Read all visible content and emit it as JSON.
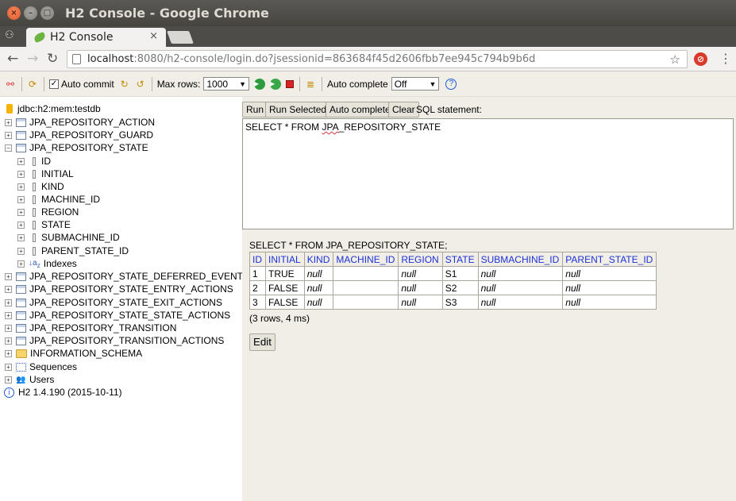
{
  "window": {
    "title": "H2 Console - Google Chrome"
  },
  "browser": {
    "tab_label": "H2 Console",
    "tab_close": "×",
    "url_host": "localhost",
    "url_rest": ":8080/h2-console/login.do?jsessionid=863684f45d2606fbb7ee945c794b9b6d",
    "icons": [
      "incognito-icon",
      "back-icon",
      "forward-icon",
      "reload-icon",
      "lock-icon",
      "star-icon",
      "extension-icon",
      "menu-icon"
    ]
  },
  "toolbar": {
    "auto_commit": "Auto commit",
    "auto_commit_checked": true,
    "max_rows_label": "Max rows:",
    "max_rows_value": "1000",
    "auto_complete_label": "Auto complete",
    "auto_complete_value": "Off"
  },
  "tree": {
    "connection": "jdbc:h2:mem:testdb",
    "tables_before": [
      "JPA_REPOSITORY_ACTION",
      "JPA_REPOSITORY_GUARD"
    ],
    "expanded_table": "JPA_REPOSITORY_STATE",
    "columns": [
      "ID",
      "INITIAL",
      "KIND",
      "MACHINE_ID",
      "REGION",
      "STATE",
      "SUBMACHINE_ID",
      "PARENT_STATE_ID"
    ],
    "indexes": "Indexes",
    "tables_after": [
      "JPA_REPOSITORY_STATE_DEFERRED_EVENTS",
      "JPA_REPOSITORY_STATE_ENTRY_ACTIONS",
      "JPA_REPOSITORY_STATE_EXIT_ACTIONS",
      "JPA_REPOSITORY_STATE_STATE_ACTIONS",
      "JPA_REPOSITORY_TRANSITION",
      "JPA_REPOSITORY_TRANSITION_ACTIONS"
    ],
    "info_schema": "INFORMATION_SCHEMA",
    "sequences": "Sequences",
    "users": "Users",
    "version": "H2 1.4.190 (2015-10-11)"
  },
  "query": {
    "run": "Run",
    "run_selected": "Run Selected",
    "auto_complete": "Auto complete",
    "clear": "Clear",
    "sql_label": "SQL statement:",
    "sql_prefix": "SELECT * FROM ",
    "sql_jpa": "JPA",
    "sql_suffix": "_REPOSITORY_STATE"
  },
  "result": {
    "title": "SELECT * FROM JPA_REPOSITORY_STATE;",
    "columns": [
      "ID",
      "INITIAL",
      "KIND",
      "MACHINE_ID",
      "REGION",
      "STATE",
      "SUBMACHINE_ID",
      "PARENT_STATE_ID"
    ],
    "rows": [
      [
        "1",
        "TRUE",
        "null",
        "",
        "null",
        "S1",
        "null",
        "null"
      ],
      [
        "2",
        "FALSE",
        "null",
        "",
        "null",
        "S2",
        "null",
        "null"
      ],
      [
        "3",
        "FALSE",
        "null",
        "",
        "null",
        "S3",
        "null",
        "null"
      ]
    ],
    "summary": "(3 rows, 4 ms)",
    "edit": "Edit"
  }
}
